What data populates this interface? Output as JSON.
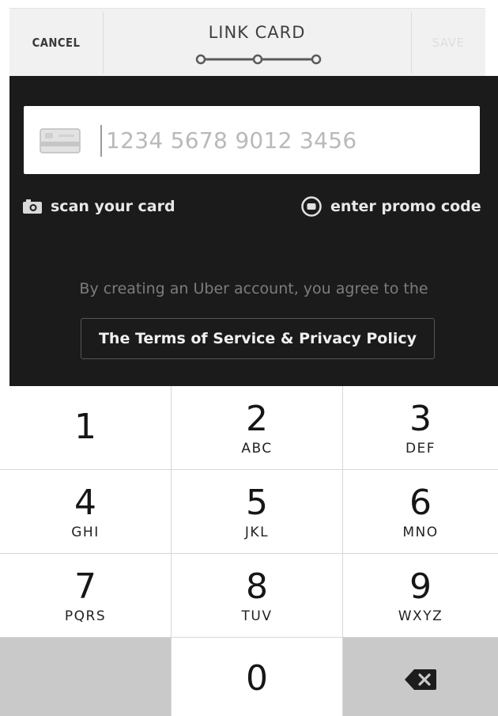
{
  "header": {
    "cancel_label": "CANCEL",
    "title": "LINK CARD",
    "save_label": "SAVE",
    "progress_steps": 3
  },
  "card_form": {
    "card_number_placeholder": "1234 5678 9012 3456",
    "card_icon": "credit-card-icon",
    "scan_label": "scan your card",
    "scan_icon": "camera-icon",
    "promo_label": "enter promo code",
    "promo_icon": "promo-circle-icon",
    "agreement_text": "By creating an Uber account, you agree to the",
    "terms_label": "The Terms of Service & Privacy Policy"
  },
  "keypad": {
    "keys": [
      {
        "digit": "1",
        "letters": ""
      },
      {
        "digit": "2",
        "letters": "ABC"
      },
      {
        "digit": "3",
        "letters": "DEF"
      },
      {
        "digit": "4",
        "letters": "GHI"
      },
      {
        "digit": "5",
        "letters": "JKL"
      },
      {
        "digit": "6",
        "letters": "MNO"
      },
      {
        "digit": "7",
        "letters": "PQRS"
      },
      {
        "digit": "8",
        "letters": "TUV"
      },
      {
        "digit": "9",
        "letters": "WXYZ"
      },
      {
        "digit": "0",
        "letters": ""
      }
    ],
    "backspace_icon": "backspace-icon"
  },
  "colors": {
    "header_bg": "#f1f1f1",
    "form_bg": "#1b1b1b",
    "keypad_bg": "#ffffff",
    "keypad_gray": "#c9c9c9",
    "text_dark": "#161616"
  }
}
